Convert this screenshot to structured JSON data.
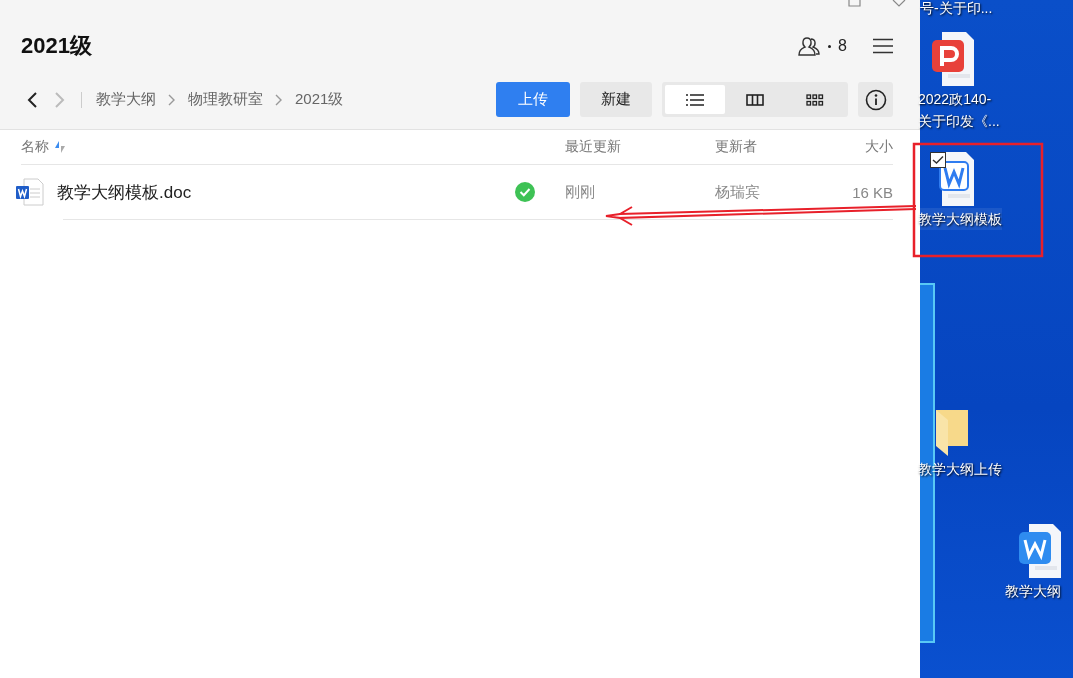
{
  "window": {
    "title": "2021级",
    "members": "8"
  },
  "nav": {
    "back_disabled": false,
    "forward_disabled": true
  },
  "breadcrumb": [
    "教学大纲",
    "物理教研室",
    "2021级"
  ],
  "toolbar": {
    "upload": "上传",
    "new": "新建",
    "views": [
      {
        "kind": "list",
        "selected": true
      },
      {
        "kind": "columns",
        "selected": false
      },
      {
        "kind": "grid",
        "selected": false
      }
    ]
  },
  "table": {
    "columns": [
      {
        "label": "名称",
        "sorted": true
      },
      {
        "label": "最近更新",
        "sorted": false
      },
      {
        "label": "更新者",
        "sorted": false
      },
      {
        "label": "大小",
        "sorted": false
      }
    ],
    "rows": [
      {
        "name": "教学大纲模板.doc",
        "synced": true,
        "updated": "刚刚",
        "updater": "杨瑞宾",
        "size": "16 KB"
      }
    ]
  },
  "desktop": {
    "icons": [
      {
        "label": "号-关于印...",
        "selected": false
      },
      {
        "kind": "pdf",
        "label": "2022政140-\n关于印发《...",
        "selected": false
      },
      {
        "kind": "doc",
        "label": "教学大纲模板",
        "selected": true
      },
      {
        "kind": "folder",
        "label": "教学大纲上传",
        "selected": false
      },
      {
        "kind": "wps",
        "label": "教学大纲",
        "selected": false
      }
    ]
  }
}
